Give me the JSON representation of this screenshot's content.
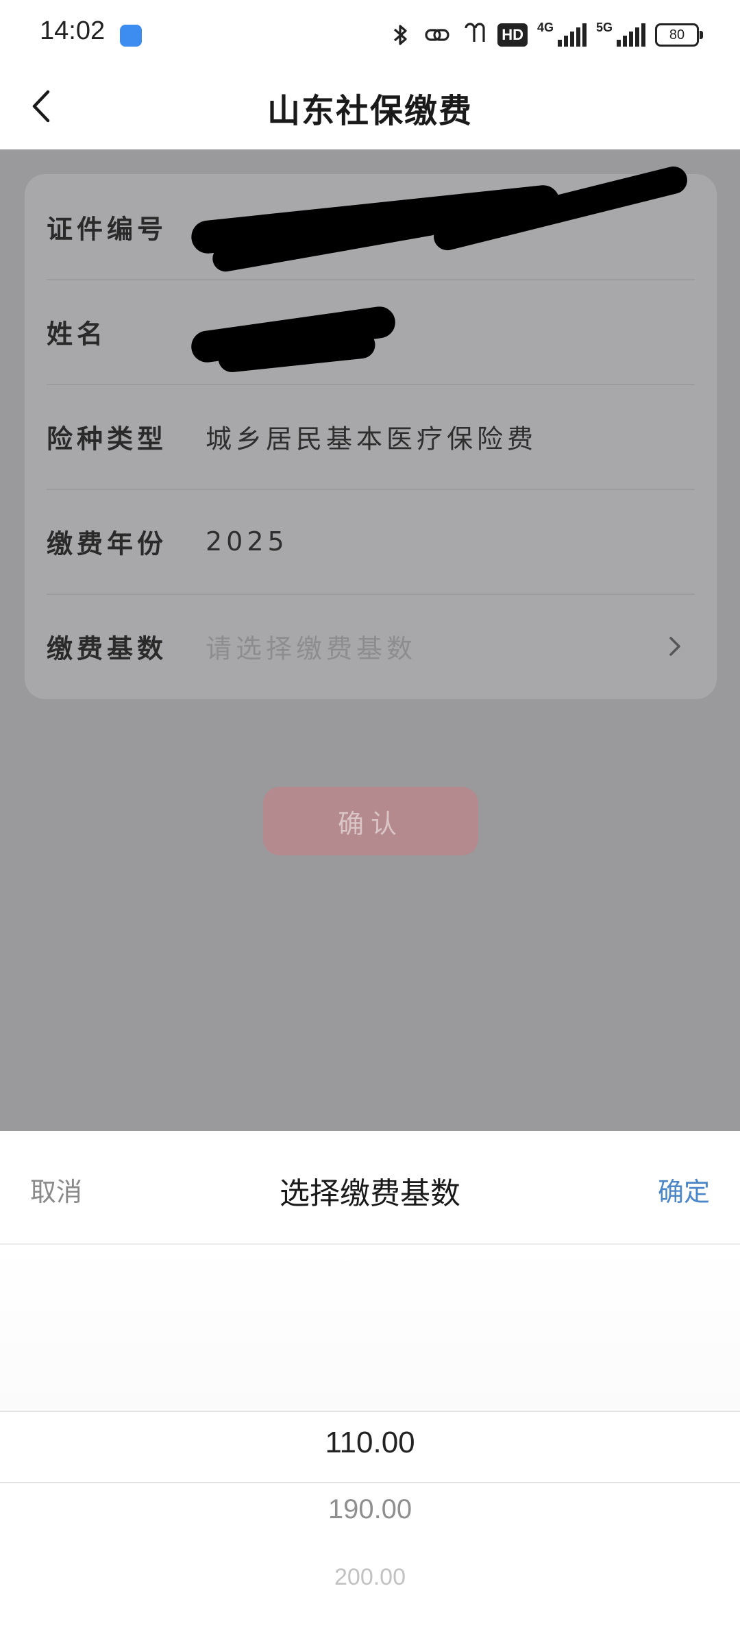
{
  "status_bar": {
    "time": "14:02",
    "hd_label": "HD",
    "network1": "4G",
    "network2": "5G",
    "battery": "80"
  },
  "nav": {
    "title": "山东社保缴费"
  },
  "form": {
    "id_label": "证件编号",
    "name_label": "姓名",
    "insurance_type_label": "险种类型",
    "insurance_type_value": "城乡居民基本医疗保险费",
    "year_label": "缴费年份",
    "year_value": "2025",
    "base_label": "缴费基数",
    "base_placeholder": "请选择缴费基数"
  },
  "confirm_label": "确认",
  "sheet": {
    "cancel": "取消",
    "title": "选择缴费基数",
    "ok": "确定",
    "options": [
      "110.00",
      "190.00",
      "200.00"
    ]
  }
}
